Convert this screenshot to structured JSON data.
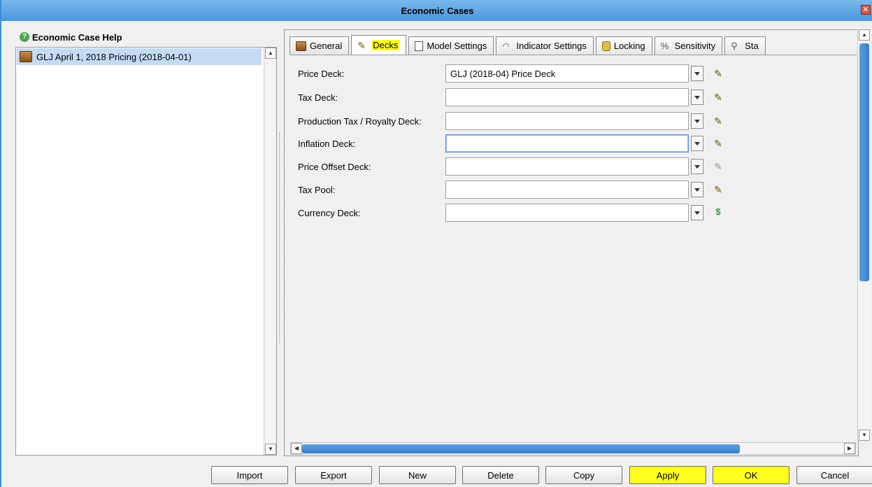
{
  "window": {
    "title": "Economic Cases"
  },
  "left": {
    "help_label": "Economic Case Help",
    "items": [
      {
        "label": "GLJ April 1, 2018 Pricing (2018-04-01)"
      }
    ]
  },
  "tabs": [
    {
      "label": "General",
      "icon": "barrel-icon"
    },
    {
      "label": "Decks",
      "icon": "deck-icon"
    },
    {
      "label": "Model Settings",
      "icon": "clipboard-icon"
    },
    {
      "label": "Indicator Settings",
      "icon": "gauge-icon"
    },
    {
      "label": "Locking",
      "icon": "lock-icon"
    },
    {
      "label": "Sensitivity",
      "icon": "percent-icon"
    },
    {
      "label": "Sta",
      "icon": "magnifier-icon"
    }
  ],
  "fields": [
    {
      "label": "Price Deck:",
      "value": "GLJ (2018-04) Price Deck"
    },
    {
      "label": "Tax Deck:",
      "value": ""
    },
    {
      "label": "Production Tax / Royalty Deck:",
      "value": ""
    },
    {
      "label": "Inflation Deck:",
      "value": ""
    },
    {
      "label": "Price Offset Deck:",
      "value": ""
    },
    {
      "label": "Tax Pool:",
      "value": ""
    },
    {
      "label": "Currency Deck:",
      "value": ""
    }
  ],
  "buttons": {
    "import": "Import",
    "export": "Export",
    "new": "New",
    "delete": "Delete",
    "copy": "Copy",
    "apply": "Apply",
    "ok": "OK",
    "cancel": "Cancel"
  },
  "colors": {
    "highlight": "#ffff20",
    "selection": "#c3dcf4",
    "titlebar": "#4a96dc"
  }
}
